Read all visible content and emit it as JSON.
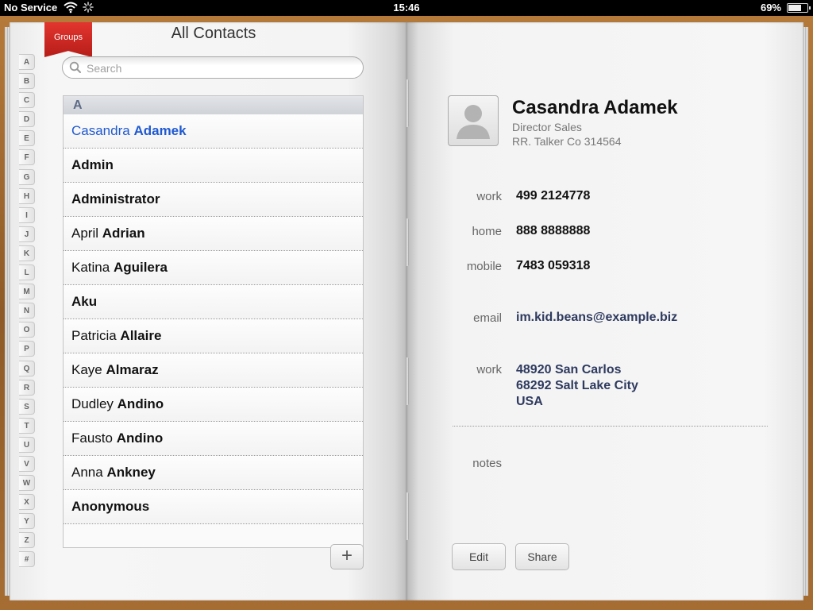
{
  "status_bar": {
    "carrier": "No Service",
    "time": "15:46",
    "battery_percent": "69%",
    "battery_level": 0.69
  },
  "groups_button": "Groups",
  "list": {
    "title": "All Contacts",
    "search_placeholder": "Search",
    "index_letters": [
      "A",
      "B",
      "C",
      "D",
      "E",
      "F",
      "G",
      "H",
      "I",
      "J",
      "K",
      "L",
      "M",
      "N",
      "O",
      "P",
      "Q",
      "R",
      "S",
      "T",
      "U",
      "V",
      "W",
      "X",
      "Y",
      "Z",
      "#"
    ],
    "section": "A",
    "contacts": [
      {
        "first": "Casandra",
        "last": "Adamek",
        "selected": true
      },
      {
        "first": "",
        "last": "Admin"
      },
      {
        "first": "",
        "last": "Administrator"
      },
      {
        "first": "April",
        "last": "Adrian"
      },
      {
        "first": "Katina",
        "last": "Aguilera"
      },
      {
        "first": "",
        "last": "Aku"
      },
      {
        "first": "Patricia",
        "last": "Allaire"
      },
      {
        "first": "Kaye",
        "last": "Almaraz"
      },
      {
        "first": "Dudley",
        "last": "Andino"
      },
      {
        "first": "Fausto",
        "last": "Andino"
      },
      {
        "first": "Anna",
        "last": "Ankney"
      },
      {
        "first": "",
        "last": "Anonymous"
      }
    ],
    "add_label": "+"
  },
  "detail": {
    "name": "Casandra Adamek",
    "job_title": "Director Sales",
    "company": "RR. Talker Co 314564",
    "phones": [
      {
        "label": "work",
        "value": "499 2124778"
      },
      {
        "label": "home",
        "value": "888 8888888"
      },
      {
        "label": "mobile",
        "value": "7483 059318"
      }
    ],
    "email": {
      "label": "email",
      "value": "im.kid.beans@example.biz"
    },
    "address": {
      "label": "work",
      "lines": [
        "48920 San Carlos",
        "68292 Salt Lake City",
        "USA"
      ]
    },
    "notes_label": "notes",
    "edit_label": "Edit",
    "share_label": "Share"
  }
}
